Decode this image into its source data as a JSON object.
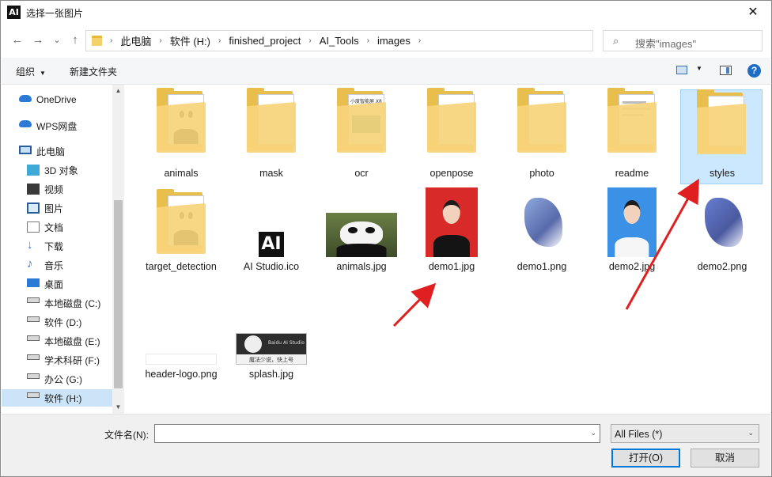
{
  "window": {
    "app_icon": "AI",
    "title": "选择一张图片",
    "close_glyph": "✕"
  },
  "nav": {
    "back_glyph": "←",
    "forward_glyph": "→",
    "recent_glyph": "⌄",
    "up_glyph": "↑",
    "refresh_glyph": "↻"
  },
  "breadcrumb": [
    "此电脑",
    "软件 (H:)",
    "finished_project",
    "AI_Tools",
    "images"
  ],
  "search": {
    "placeholder": "搜索\"images\""
  },
  "toolbar": {
    "organize": "组织",
    "new_folder": "新建文件夹",
    "help": "?"
  },
  "sidebar": {
    "items": [
      {
        "label": "OneDrive",
        "icon": "cloud-icon"
      },
      {
        "label": "WPS网盘",
        "icon": "wps-cloud-icon"
      },
      {
        "label": "此电脑",
        "icon": "computer-icon"
      },
      {
        "label": "3D 对象",
        "icon": "3d-objects-icon"
      },
      {
        "label": "视频",
        "icon": "video-icon"
      },
      {
        "label": "图片",
        "icon": "pictures-icon"
      },
      {
        "label": "文档",
        "icon": "documents-icon"
      },
      {
        "label": "下载",
        "icon": "download-icon"
      },
      {
        "label": "音乐",
        "icon": "music-icon"
      },
      {
        "label": "桌面",
        "icon": "desktop-icon"
      },
      {
        "label": "本地磁盘 (C:)",
        "icon": "drive-icon"
      },
      {
        "label": "软件 (D:)",
        "icon": "drive-icon"
      },
      {
        "label": "本地磁盘 (E:)",
        "icon": "drive-icon"
      },
      {
        "label": "学术科研 (F:)",
        "icon": "drive-icon"
      },
      {
        "label": "办公 (G:)",
        "icon": "drive-icon"
      },
      {
        "label": "软件 (H:)",
        "icon": "drive-icon"
      }
    ],
    "selected": "软件 (H:)"
  },
  "files": [
    {
      "name": "animals",
      "kind": "folder"
    },
    {
      "name": "mask",
      "kind": "folder"
    },
    {
      "name": "ocr",
      "kind": "folder"
    },
    {
      "name": "openpose",
      "kind": "folder"
    },
    {
      "name": "photo",
      "kind": "folder"
    },
    {
      "name": "readme",
      "kind": "folder"
    },
    {
      "name": "styles",
      "kind": "folder",
      "selected": true
    },
    {
      "name": "target_detection",
      "kind": "folder"
    },
    {
      "name": "AI Studio.ico",
      "kind": "icon-file"
    },
    {
      "name": "animals.jpg",
      "kind": "image"
    },
    {
      "name": "demo1.jpg",
      "kind": "image"
    },
    {
      "name": "demo1.png",
      "kind": "image"
    },
    {
      "name": "demo2.jpg",
      "kind": "image"
    },
    {
      "name": "demo2.png",
      "kind": "image"
    },
    {
      "name": "header-logo.png",
      "kind": "image"
    },
    {
      "name": "splash.jpg",
      "kind": "image"
    }
  ],
  "thumb_text": {
    "ai_logo": "AI",
    "splash_brand": "Baidu AI Studio",
    "splash_caption": "魔法少说，快上号",
    "ocr_header": "小度智能屏 X8"
  },
  "bottom": {
    "filename_label": "文件名(N):",
    "filename_value": "",
    "filetype_value": "All Files (*)",
    "open_button": "打开(O)",
    "cancel_button": "取消"
  },
  "colors": {
    "selection_fill": "#cce8ff",
    "selection_border": "#99d1ff",
    "arrow": "#e02020",
    "primary_button_border": "#0078d7"
  }
}
